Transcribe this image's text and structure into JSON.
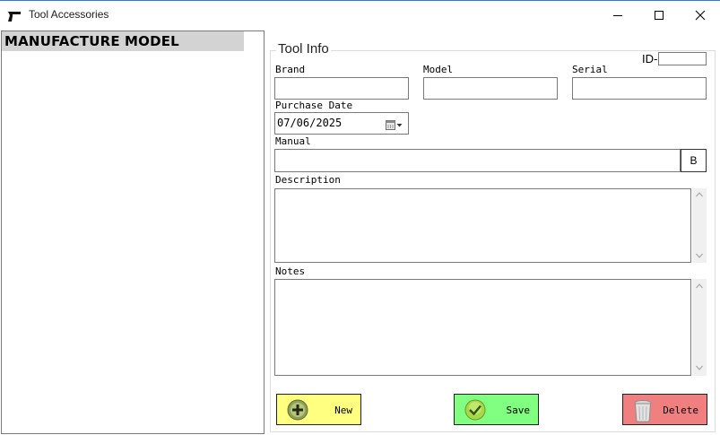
{
  "window": {
    "title": "Tool Accessories",
    "accent": "#2b79c9"
  },
  "list": {
    "columns": [
      "MANUFACTURE",
      "MODEL"
    ],
    "header_bg": "#d3d3d3",
    "rows": []
  },
  "form": {
    "group_title": "Tool Info",
    "id_label": "ID-",
    "id_value": "",
    "brand_label": "Brand",
    "brand_value": "",
    "model_label": "Model",
    "model_value": "",
    "serial_label": "Serial",
    "serial_value": "",
    "purchase_date_label": "Purchase Date",
    "purchase_date_value": "07/06/2025",
    "manual_label": "Manual",
    "manual_value": "",
    "browse_label": "B",
    "description_label": "Description",
    "description_value": "",
    "notes_label": "Notes",
    "notes_value": ""
  },
  "actions": {
    "new_label": "New",
    "new_color": "#ffff80",
    "save_label": "Save",
    "save_color": "#80ff80",
    "delete_label": "Delete",
    "delete_color": "#f08080"
  },
  "icons": {
    "app": "pistol-icon",
    "minimize": "minimize-icon",
    "maximize": "maximize-icon",
    "close": "close-icon",
    "calendar": "calendar-dropdown-icon",
    "new": "plus-circle-icon",
    "save": "check-circle-icon",
    "delete": "trash-can-icon"
  }
}
